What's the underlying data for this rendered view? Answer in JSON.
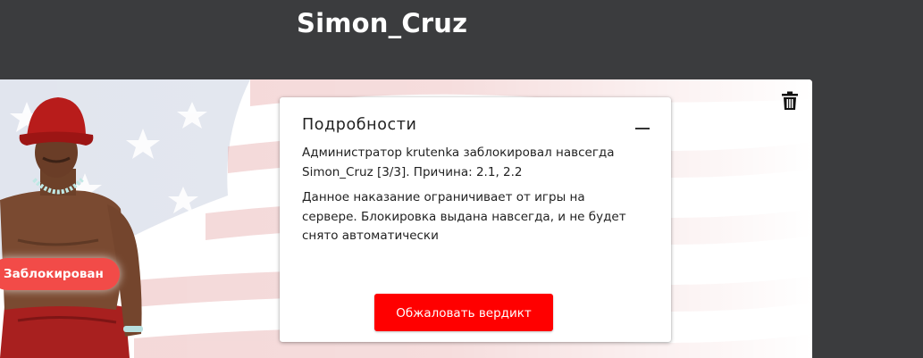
{
  "header": {
    "title": "Simon_Cruz"
  },
  "profile": {
    "status_badge": "Заблокирован"
  },
  "details_card": {
    "title": "Подробности",
    "ban_info": "Администратор krutenka заблокировал навсегда Simon_Cruz [3/3]. Причина: 2.1, 2.2",
    "ban_description": "Данное наказание ограничивает от игры на сервере. Блокировка выдана навсегда, и не будет снято автоматически",
    "appeal_button": "Обжаловать вердикт"
  },
  "icons": {
    "delete": "trash-icon",
    "collapse": "minus-icon"
  },
  "colors": {
    "header_bg": "#3b3c3e",
    "accent_red": "#ff0000",
    "badge_red": "#f24b48"
  }
}
